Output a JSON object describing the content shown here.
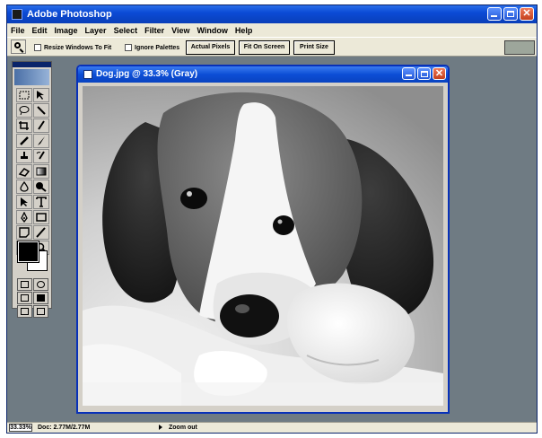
{
  "app": {
    "title": "Adobe Photoshop",
    "menu": [
      "File",
      "Edit",
      "Image",
      "Layer",
      "Select",
      "Filter",
      "View",
      "Window",
      "Help"
    ]
  },
  "options_bar": {
    "tool_icon": "zoom-icon",
    "resize_windows_label": "Resize Windows To Fit",
    "ignore_palettes_label": "Ignore Palettes",
    "actual_pixels_label": "Actual Pixels",
    "fit_on_screen_label": "Fit On Screen",
    "print_size_label": "Print Size"
  },
  "document": {
    "title": "Dog.jpg @ 33.3% (Gray)",
    "image_subject": "beagle-puppy-grayscale-photo"
  },
  "status_bar": {
    "zoom": "33.33%",
    "doc_info": "Doc: 2.77M/2.77M",
    "hint": "Zoom out"
  },
  "colors": {
    "workspace": "#6f7b83",
    "title_bar": "#0b4bd6",
    "foreground_swatch": "#000000",
    "background_swatch": "#ffffff"
  }
}
